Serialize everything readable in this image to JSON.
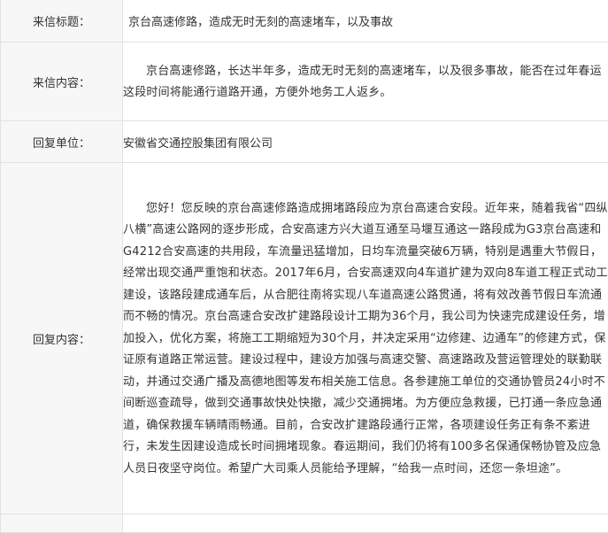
{
  "rows": {
    "title": {
      "label": "来信标题：",
      "value": "京台高速修路，造成无时无刻的高速堵车，以及事故"
    },
    "content": {
      "label": "来信内容：",
      "value": "京台高速修路，长达半年多，造成无时无刻的高速堵车，以及很多事故，能否在过年春运这段时间将能通行道路开通，方便外地务工人返乡。"
    },
    "unit": {
      "label": "回复单位：",
      "value": "安徽省交通控股集团有限公司"
    },
    "reply": {
      "label": "回复内容：",
      "value": "您好！您反映的京台高速修路造成拥堵路段应为京台高速合安段。近年来，随着我省“四纵八横”高速公路网的逐步形成，合安高速方兴大道互通至马堰互通这一路段成为G3京台高速和G4212合安高速的共用段，车流量迅猛增加，日均车流量突破6万辆，特别是遇重大节假日，经常出现交通严重饱和状态。2017年6月，合安高速双向4车道扩建为双向8车道工程正式动工建设，该路段建成通车后，从合肥往南将实现八车道高速公路贯通，将有效改善节假日车流通而不畅的情况。京台高速合安改扩建路段设计工期为36个月，我公司为快速完成建设任务，增加投入，优化方案，将施工工期缩短为30个月，并决定采用“边修建、边通车”的修建方式，保证原有道路正常运营。建设过程中，建设方加强与高速交警、高速路政及营运管理处的联勤联动，并通过交通广播及高德地图等发布相关施工信息。各参建施工单位的交通协管员24小时不间断巡查疏导，做到交通事故快处快撤，减少交通拥堵。为方便应急救援，已打通一条应急通道，确保救援车辆晴雨畅通。目前，合安改扩建路段通行正常，各项建设任务正有条不紊进行，未发生因建设造成长时间拥堵现象。春运期间，我们仍将有100多名保通保畅协管及应急人员日夜坚守岗位。希望广大司乘人员能给予理解，“给我一点时间，还您一条坦途”。"
    }
  }
}
